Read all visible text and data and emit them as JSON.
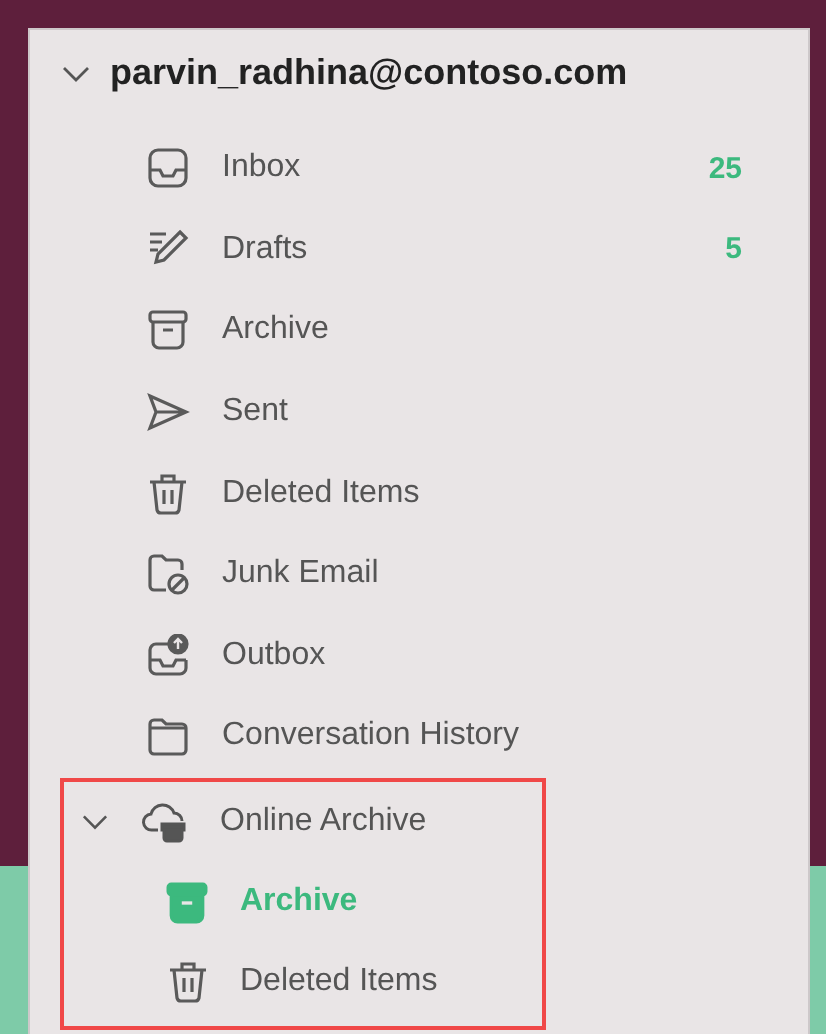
{
  "account": {
    "name": "parvin_radhina@contoso.com",
    "expanded": true
  },
  "folders": [
    {
      "label": "Inbox",
      "kind": "inbox",
      "count": "25",
      "selected": false
    },
    {
      "label": "Drafts",
      "kind": "drafts",
      "count": "5",
      "selected": false
    },
    {
      "label": "Archive",
      "kind": "archive",
      "selected": false
    },
    {
      "label": "Sent",
      "kind": "sent",
      "selected": false
    },
    {
      "label": "Deleted Items",
      "kind": "trash",
      "selected": false
    },
    {
      "label": "Junk Email",
      "kind": "junk",
      "selected": false
    },
    {
      "label": "Outbox",
      "kind": "outbox",
      "selected": false
    },
    {
      "label": "Conversation History",
      "kind": "folder",
      "selected": false
    }
  ],
  "online_archive": {
    "label": "Online Archive",
    "expanded": true,
    "highlighted": true,
    "children": [
      {
        "label": "Archive",
        "kind": "archive",
        "selected": true
      },
      {
        "label": "Deleted Items",
        "kind": "trash",
        "selected": false
      }
    ]
  }
}
